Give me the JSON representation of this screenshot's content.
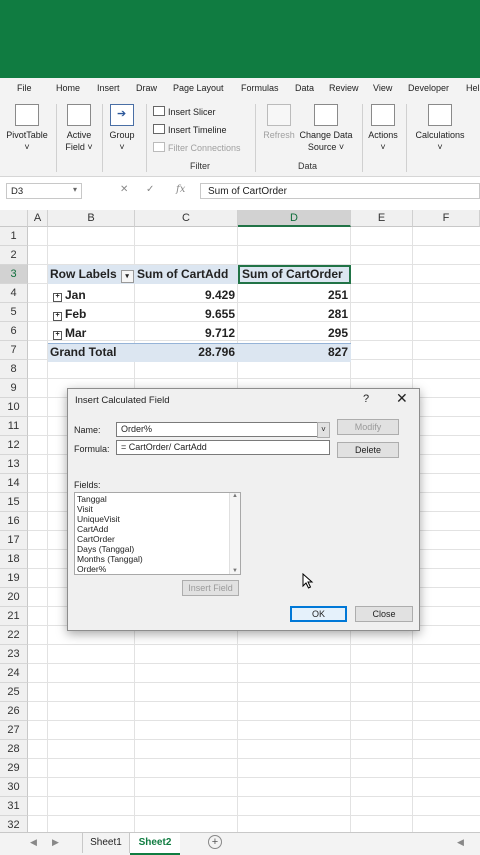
{
  "menu": {
    "tabs": [
      "File",
      "Home",
      "Insert",
      "Draw",
      "Page Layout",
      "Formulas",
      "Data",
      "Review",
      "View",
      "Developer",
      "Help"
    ]
  },
  "ribbon": {
    "pivottable": "PivotTable",
    "active_field_1": "Active",
    "active_field_2": "Field ˅",
    "group": "Group",
    "insert_slicer": "Insert Slicer",
    "insert_timeline": "Insert Timeline",
    "filter_connections": "Filter Connections",
    "filter_group": "Filter",
    "refresh": "Refresh",
    "change_source_1": "Change Data",
    "change_source_2": "Source ˅",
    "data_group": "Data",
    "actions": "Actions",
    "calculations": "Calculations"
  },
  "formula_bar": {
    "name_box": "D3",
    "formula": "Sum of CartOrder"
  },
  "sheet": {
    "columns": [
      "A",
      "B",
      "C",
      "D",
      "E",
      "F"
    ],
    "rows": [
      "1",
      "2",
      "3",
      "4",
      "5",
      "6",
      "7",
      "8",
      "9",
      "10",
      "11",
      "12",
      "13",
      "14",
      "15",
      "16",
      "17",
      "18",
      "19",
      "20",
      "21",
      "22",
      "23",
      "24",
      "25",
      "26",
      "27",
      "28",
      "29",
      "30",
      "31",
      "32"
    ],
    "pivot": {
      "header": [
        "Row Labels",
        "Sum of CartAdd",
        "Sum of CartOrder"
      ],
      "rows": [
        {
          "label": "Jan",
          "cartadd": "9.429",
          "cartorder": "251"
        },
        {
          "label": "Feb",
          "cartadd": "9.655",
          "cartorder": "281"
        },
        {
          "label": "Mar",
          "cartadd": "9.712",
          "cartorder": "295"
        }
      ],
      "total": {
        "label": "Grand Total",
        "cartadd": "28.796",
        "cartorder": "827"
      }
    }
  },
  "dialog": {
    "title": "Insert Calculated Field",
    "name_label": "Name:",
    "name_value": "Order%",
    "formula_label": "Formula:",
    "formula_value": "= CartOrder/ CartAdd",
    "modify": "Modify",
    "delete": "Delete",
    "fields_label": "Fields:",
    "fields": [
      "Tanggal",
      "Visit",
      "UniqueVisit",
      "CartAdd",
      "CartOrder",
      "Days (Tanggal)",
      "Months (Tanggal)",
      "Order%"
    ],
    "insert_field": "Insert Field",
    "ok": "OK",
    "close": "Close"
  },
  "sheet_tabs": [
    "Sheet1",
    "Sheet2"
  ],
  "colors": {
    "excel_green": "#107c41",
    "pivot_header": "#dce6f1",
    "selection": "#217346"
  }
}
